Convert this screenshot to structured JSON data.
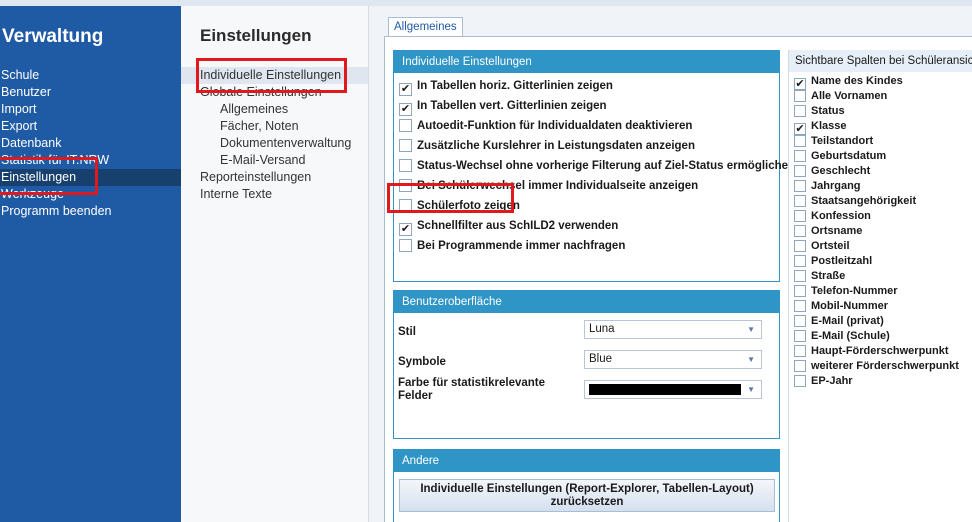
{
  "nav": {
    "title": "Verwaltung",
    "items": [
      {
        "label": "Schule"
      },
      {
        "label": "Benutzer"
      },
      {
        "label": "Import"
      },
      {
        "label": "Export"
      },
      {
        "label": "Datenbank"
      },
      {
        "label": "Statistik für IT.NRW"
      },
      {
        "label": "Einstellungen"
      },
      {
        "label": "Werkzeuge"
      },
      {
        "label": "Programm beenden"
      }
    ]
  },
  "settings_nav": {
    "title": "Einstellungen",
    "items": [
      {
        "label": "Individuelle Einstellungen"
      },
      {
        "label": "Globale Einstellungen"
      },
      {
        "label": "Allgemeines"
      },
      {
        "label": "Fächer, Noten"
      },
      {
        "label": "Dokumentenverwaltung"
      },
      {
        "label": "E-Mail-Versand"
      },
      {
        "label": "Reporteinstellungen"
      },
      {
        "label": "Interne Texte"
      }
    ]
  },
  "tab": {
    "label": "Allgemeines"
  },
  "individual": {
    "title": "Individuelle Einstellungen",
    "options": [
      {
        "label": "In Tabellen horiz. Gitterlinien zeigen",
        "checked": true
      },
      {
        "label": "In Tabellen vert. Gitterlinien zeigen",
        "checked": true
      },
      {
        "label": "Autoedit-Funktion für Individualdaten deaktivieren",
        "checked": false
      },
      {
        "label": "Zusätzliche Kurslehrer in Leistungsdaten anzeigen",
        "checked": false
      },
      {
        "label": "Status-Wechsel ohne vorherige Filterung auf Ziel-Status ermöglichen",
        "checked": false
      },
      {
        "label": "Bei Schülerwechsel immer Individualseite anzeigen",
        "checked": false
      },
      {
        "label": "Schülerfoto zeigen",
        "checked": false
      },
      {
        "label": "Schnellfilter aus SchILD2 verwenden",
        "checked": true
      },
      {
        "label": "Bei Programmende immer nachfragen",
        "checked": false
      }
    ]
  },
  "ui": {
    "title": "Benutzeroberfläche",
    "style_label": "Stil",
    "style_value": "Luna",
    "symbols_label": "Symbole",
    "symbols_value": "Blue",
    "color_label": "Farbe für statistikrelevante Felder",
    "color_value": "#000000"
  },
  "other": {
    "title": "Andere",
    "reset_button": "Individuelle Einstellungen (Report-Explorer, Tabellen-Layout) zurücksetzen"
  },
  "columns": {
    "title": "Sichtbare Spalten bei Schüleransicht",
    "items": [
      {
        "label": "Name des Kindes",
        "checked": true
      },
      {
        "label": "Alle Vornamen",
        "checked": false
      },
      {
        "label": "Status",
        "checked": false
      },
      {
        "label": "Klasse",
        "checked": true
      },
      {
        "label": "Teilstandort",
        "checked": false
      },
      {
        "label": "Geburtsdatum",
        "checked": false
      },
      {
        "label": "Geschlecht",
        "checked": false
      },
      {
        "label": "Jahrgang",
        "checked": false
      },
      {
        "label": "Staatsangehörigkeit",
        "checked": false
      },
      {
        "label": "Konfession",
        "checked": false
      },
      {
        "label": "Ortsname",
        "checked": false
      },
      {
        "label": "Ortsteil",
        "checked": false
      },
      {
        "label": "Postleitzahl",
        "checked": false
      },
      {
        "label": "Straße",
        "checked": false
      },
      {
        "label": "Telefon-Nummer",
        "checked": false
      },
      {
        "label": "Mobil-Nummer",
        "checked": false
      },
      {
        "label": "E-Mail (privat)",
        "checked": false
      },
      {
        "label": "E-Mail (Schule)",
        "checked": false
      },
      {
        "label": "Haupt-Förderschwerpunkt",
        "checked": false
      },
      {
        "label": "weiterer Förderschwerpunkt",
        "checked": false
      },
      {
        "label": "EP-Jahr",
        "checked": false
      }
    ]
  },
  "colors": {
    "nav_bg": "#1f5aa5",
    "group_header": "#2f95c7",
    "highlight": "#e0191e"
  },
  "icons": {
    "checkmark": "check-icon",
    "dropdown": "chevron-down-icon"
  }
}
